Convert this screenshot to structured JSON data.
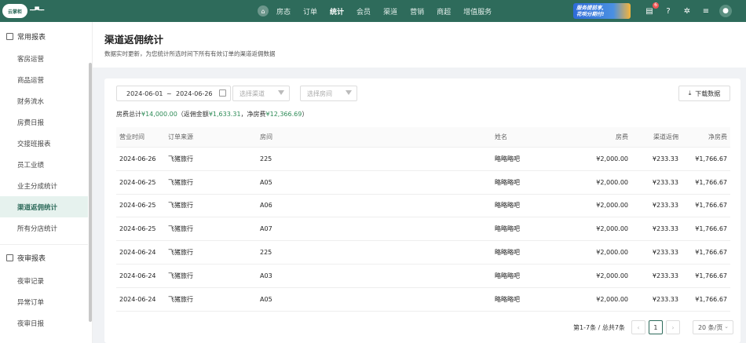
{
  "topbar": {
    "logo_text": "云掌柜",
    "nav_items": [
      "房态",
      "订单",
      "统计",
      "会员",
      "渠道",
      "营销",
      "商超",
      "增值服务"
    ],
    "active_nav": "统计",
    "promo": {
      "line1": "服务提前享,",
      "line2": "花呗分期付!"
    },
    "message_badge": "6"
  },
  "sidebar": {
    "groups": [
      {
        "label": "常用报表",
        "items": [
          "客房运营",
          "商品运营",
          "财务流水",
          "房费日报",
          "交接班报表",
          "员工业绩",
          "业主分成统计",
          "渠道返佣统计",
          "所有分店统计"
        ]
      },
      {
        "label": "夜审报表",
        "items": [
          "夜审记录",
          "异常订单",
          "夜审日报"
        ]
      }
    ],
    "active_item": "渠道返佣统计"
  },
  "page": {
    "title": "渠道返佣统计",
    "subtitle": "数据实时更新，为您统计所选时间下所有有效订单的渠道返佣数据"
  },
  "filters": {
    "date_start": "2024-06-01",
    "date_sep": "~",
    "date_end": "2024-06-26",
    "channel_placeholder": "选择渠道",
    "room_placeholder": "选择房间",
    "download_label": "下载数据"
  },
  "summary": {
    "prefix": "房费总计",
    "total": "¥14,000.00",
    "commission_prefix": "（返佣金额",
    "commission": "¥1,633.31",
    "net_prefix": "，净房费",
    "net": "¥12,366.69",
    "suffix": "）"
  },
  "table": {
    "headers": [
      "营业时间",
      "订单来源",
      "房间",
      "姓名",
      "房费",
      "渠道返佣",
      "净房费"
    ],
    "rows": [
      [
        "2024-06-26",
        "飞猪旅行",
        "225",
        "略略略吧",
        "¥2,000.00",
        "¥233.33",
        "¥1,766.67"
      ],
      [
        "2024-06-25",
        "飞猪旅行",
        "A05",
        "略略略吧",
        "¥2,000.00",
        "¥233.33",
        "¥1,766.67"
      ],
      [
        "2024-06-25",
        "飞猪旅行",
        "A06",
        "略略略吧",
        "¥2,000.00",
        "¥233.33",
        "¥1,766.67"
      ],
      [
        "2024-06-25",
        "飞猪旅行",
        "A07",
        "略略略吧",
        "¥2,000.00",
        "¥233.33",
        "¥1,766.67"
      ],
      [
        "2024-06-24",
        "飞猪旅行",
        "225",
        "略略略吧",
        "¥2,000.00",
        "¥233.33",
        "¥1,766.67"
      ],
      [
        "2024-06-24",
        "飞猪旅行",
        "A03",
        "略略略吧",
        "¥2,000.00",
        "¥233.33",
        "¥1,766.67"
      ],
      [
        "2024-06-24",
        "飞猪旅行",
        "A05",
        "略略略吧",
        "¥2,000.00",
        "¥233.33",
        "¥1,766.67"
      ]
    ]
  },
  "pagination": {
    "info": "第1-7条 / 总共7条",
    "current_page": "1",
    "page_size": "20 条/页"
  },
  "colors": {
    "brand": "#2e6b5b",
    "accent_number": "#2e8b57"
  }
}
